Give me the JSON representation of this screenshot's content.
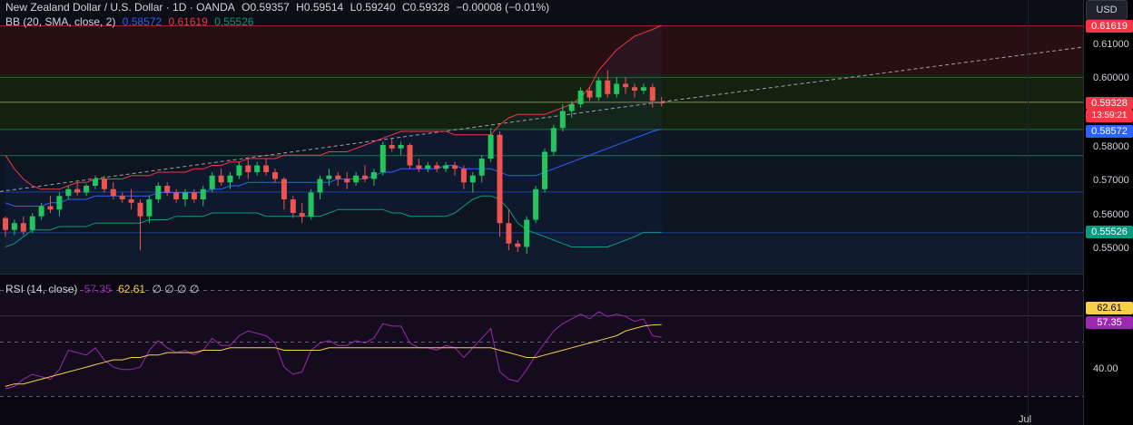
{
  "header": {
    "symbol": "New Zealand Dollar / U.S. Dollar · 1D · OANDA",
    "open_label": "O",
    "open": "0.59357",
    "high_label": "H",
    "high": "0.59514",
    "low_label": "L",
    "low": "0.59240",
    "close_label": "C",
    "close": "0.59328",
    "change": "−0.00008 (−0.01%)"
  },
  "bb_legend": {
    "label": "BB (20, SMA, close, 2)",
    "basis": "0.58572",
    "upper": "0.61619",
    "lower": "0.55526"
  },
  "rsi_legend": {
    "label": "RSI (14, close)",
    "rsi": "57.35",
    "ma": "62.61",
    "extra": "∅ ∅ ∅ ∅"
  },
  "currency_button": "USD",
  "price_axis": {
    "labels": [
      "0.61000",
      "0.60000",
      "0.58000",
      "0.57000",
      "0.56000",
      "0.55000"
    ],
    "upper_tag": "0.61619",
    "close_tag": "0.59328",
    "countdown": "13:59:21",
    "basis_tag": "0.58572",
    "lower_tag": "0.55526"
  },
  "rsi_axis": {
    "ma_tag": "62.61",
    "rsi_tag": "57.35",
    "label_40": "40.00"
  },
  "time_axis": {
    "label": "Jul"
  },
  "colors": {
    "up": "#26a69a",
    "up_body": "#22c55e",
    "down": "#ef5350",
    "bb_upper": "#f23645",
    "bb_basis": "#2962ff",
    "bb_lower": "#089981",
    "rsi": "#9c27b0",
    "rsi_ma": "#f7d046"
  },
  "chart_data": {
    "type": "candlestick",
    "price_range": [
      0.5485,
      0.6165
    ],
    "candles": [
      [
        0.5595,
        0.56,
        0.554,
        0.556
      ],
      [
        0.556,
        0.559,
        0.5545,
        0.558
      ],
      [
        0.558,
        0.56,
        0.5545,
        0.5555
      ],
      [
        0.556,
        0.561,
        0.555,
        0.56
      ],
      [
        0.56,
        0.564,
        0.559,
        0.563
      ],
      [
        0.563,
        0.566,
        0.561,
        0.562
      ],
      [
        0.562,
        0.567,
        0.56,
        0.566
      ],
      [
        0.566,
        0.569,
        0.565,
        0.568
      ],
      [
        0.568,
        0.57,
        0.566,
        0.567
      ],
      [
        0.567,
        0.5695,
        0.566,
        0.569
      ],
      [
        0.569,
        0.572,
        0.568,
        0.571
      ],
      [
        0.571,
        0.572,
        0.567,
        0.568
      ],
      [
        0.568,
        0.57,
        0.565,
        0.566
      ],
      [
        0.566,
        0.567,
        0.564,
        0.565
      ],
      [
        0.565,
        0.568,
        0.562,
        0.564
      ],
      [
        0.564,
        0.565,
        0.55,
        0.56
      ],
      [
        0.56,
        0.566,
        0.558,
        0.565
      ],
      [
        0.565,
        0.57,
        0.564,
        0.569
      ],
      [
        0.569,
        0.57,
        0.566,
        0.567
      ],
      [
        0.567,
        0.568,
        0.564,
        0.565
      ],
      [
        0.565,
        0.568,
        0.563,
        0.567
      ],
      [
        0.567,
        0.568,
        0.564,
        0.565
      ],
      [
        0.565,
        0.569,
        0.563,
        0.568
      ],
      [
        0.568,
        0.573,
        0.567,
        0.572
      ],
      [
        0.572,
        0.574,
        0.569,
        0.57
      ],
      [
        0.57,
        0.573,
        0.568,
        0.572
      ],
      [
        0.572,
        0.576,
        0.571,
        0.575
      ],
      [
        0.575,
        0.577,
        0.571,
        0.573
      ],
      [
        0.573,
        0.576,
        0.572,
        0.575
      ],
      [
        0.575,
        0.577,
        0.572,
        0.573
      ],
      [
        0.573,
        0.574,
        0.57,
        0.571
      ],
      [
        0.571,
        0.5715,
        0.562,
        0.565
      ],
      [
        0.565,
        0.566,
        0.5595,
        0.561
      ],
      [
        0.561,
        0.564,
        0.558,
        0.56
      ],
      [
        0.56,
        0.568,
        0.559,
        0.567
      ],
      [
        0.567,
        0.572,
        0.565,
        0.571
      ],
      [
        0.571,
        0.574,
        0.569,
        0.572
      ],
      [
        0.572,
        0.573,
        0.569,
        0.571
      ],
      [
        0.571,
        0.573,
        0.568,
        0.57
      ],
      [
        0.57,
        0.573,
        0.569,
        0.572
      ],
      [
        0.572,
        0.575,
        0.57,
        0.571
      ],
      [
        0.571,
        0.574,
        0.569,
        0.573
      ],
      [
        0.573,
        0.582,
        0.572,
        0.581
      ],
      [
        0.581,
        0.583,
        0.579,
        0.58
      ],
      [
        0.58,
        0.582,
        0.578,
        0.581
      ],
      [
        0.581,
        0.5815,
        0.574,
        0.575
      ],
      [
        0.575,
        0.577,
        0.573,
        0.574
      ],
      [
        0.574,
        0.576,
        0.573,
        0.575
      ],
      [
        0.575,
        0.576,
        0.573,
        0.574
      ],
      [
        0.574,
        0.576,
        0.573,
        0.575
      ],
      [
        0.575,
        0.576,
        0.572,
        0.574
      ],
      [
        0.574,
        0.575,
        0.568,
        0.57
      ],
      [
        0.57,
        0.573,
        0.567,
        0.572
      ],
      [
        0.572,
        0.578,
        0.57,
        0.577
      ],
      [
        0.577,
        0.586,
        0.576,
        0.584
      ],
      [
        0.584,
        0.585,
        0.554,
        0.558
      ],
      [
        0.558,
        0.562,
        0.55,
        0.552
      ],
      [
        0.552,
        0.553,
        0.5495,
        0.551
      ],
      [
        0.551,
        0.56,
        0.549,
        0.559
      ],
      [
        0.559,
        0.569,
        0.558,
        0.568
      ],
      [
        0.568,
        0.58,
        0.567,
        0.579
      ],
      [
        0.579,
        0.587,
        0.578,
        0.586
      ],
      [
        0.586,
        0.593,
        0.585,
        0.591
      ],
      [
        0.591,
        0.594,
        0.589,
        0.593
      ],
      [
        0.593,
        0.598,
        0.592,
        0.597
      ],
      [
        0.597,
        0.598,
        0.594,
        0.595
      ],
      [
        0.595,
        0.601,
        0.594,
        0.6
      ],
      [
        0.6,
        0.603,
        0.595,
        0.596
      ],
      [
        0.596,
        0.601,
        0.595,
        0.599
      ],
      [
        0.599,
        0.601,
        0.596,
        0.598
      ],
      [
        0.598,
        0.599,
        0.595,
        0.597
      ],
      [
        0.597,
        0.599,
        0.596,
        0.598
      ],
      [
        0.598,
        0.599,
        0.592,
        0.594
      ],
      [
        0.5935,
        0.5951,
        0.5924,
        0.5933
      ]
    ],
    "bb_upper": [
      0.578,
      0.574,
      0.571,
      0.569,
      0.568,
      0.568,
      0.568,
      0.569,
      0.57,
      0.57,
      0.571,
      0.571,
      0.571,
      0.571,
      0.572,
      0.572,
      0.572,
      0.573,
      0.573,
      0.573,
      0.573,
      0.574,
      0.574,
      0.575,
      0.575,
      0.576,
      0.576,
      0.577,
      0.577,
      0.577,
      0.577,
      0.578,
      0.578,
      0.578,
      0.578,
      0.578,
      0.579,
      0.579,
      0.579,
      0.58,
      0.581,
      0.582,
      0.583,
      0.584,
      0.585,
      0.585,
      0.585,
      0.585,
      0.585,
      0.585,
      0.584,
      0.584,
      0.584,
      0.584,
      0.584,
      0.587,
      0.589,
      0.59,
      0.59,
      0.59,
      0.59,
      0.591,
      0.592,
      0.593,
      0.595,
      0.598,
      0.603,
      0.606,
      0.609,
      0.611,
      0.613,
      0.614,
      0.615,
      0.6162
    ],
    "bb_basis": [
      0.564,
      0.563,
      0.563,
      0.563,
      0.563,
      0.564,
      0.564,
      0.565,
      0.565,
      0.565,
      0.566,
      0.566,
      0.566,
      0.566,
      0.566,
      0.566,
      0.566,
      0.567,
      0.567,
      0.567,
      0.567,
      0.567,
      0.567,
      0.568,
      0.568,
      0.569,
      0.569,
      0.57,
      0.57,
      0.57,
      0.57,
      0.57,
      0.57,
      0.57,
      0.57,
      0.57,
      0.57,
      0.571,
      0.571,
      0.571,
      0.571,
      0.572,
      0.573,
      0.573,
      0.574,
      0.574,
      0.574,
      0.574,
      0.574,
      0.575,
      0.575,
      0.574,
      0.574,
      0.574,
      0.574,
      0.573,
      0.572,
      0.572,
      0.572,
      0.572,
      0.573,
      0.574,
      0.575,
      0.576,
      0.577,
      0.578,
      0.579,
      0.58,
      0.581,
      0.582,
      0.583,
      0.584,
      0.585,
      0.5857
    ],
    "bb_lower": [
      0.551,
      0.552,
      0.554,
      0.556,
      0.556,
      0.556,
      0.557,
      0.557,
      0.557,
      0.557,
      0.558,
      0.558,
      0.558,
      0.558,
      0.558,
      0.558,
      0.559,
      0.559,
      0.559,
      0.56,
      0.56,
      0.56,
      0.56,
      0.561,
      0.561,
      0.561,
      0.561,
      0.561,
      0.561,
      0.56,
      0.56,
      0.56,
      0.56,
      0.56,
      0.56,
      0.56,
      0.561,
      0.562,
      0.562,
      0.562,
      0.562,
      0.562,
      0.562,
      0.561,
      0.561,
      0.56,
      0.56,
      0.56,
      0.56,
      0.56,
      0.561,
      0.563,
      0.565,
      0.566,
      0.566,
      0.565,
      0.562,
      0.558,
      0.556,
      0.555,
      0.554,
      0.553,
      0.552,
      0.551,
      0.551,
      0.551,
      0.551,
      0.551,
      0.552,
      0.553,
      0.554,
      0.5553,
      0.5553,
      0.5553
    ],
    "rsi": [
      36,
      37,
      40,
      42,
      41,
      40,
      44,
      52,
      51,
      50,
      53,
      48,
      45,
      44,
      44,
      45,
      52,
      56,
      53,
      51,
      52,
      50,
      52,
      57,
      54,
      54,
      58,
      60,
      59,
      58,
      55,
      45,
      42,
      43,
      52,
      55,
      56,
      54,
      54,
      56,
      55,
      57,
      63,
      62,
      62,
      55,
      53,
      53,
      52,
      54,
      53,
      49,
      53,
      57,
      61,
      43,
      40,
      39,
      44,
      50,
      55,
      60,
      63,
      65,
      67,
      65,
      68,
      66,
      67,
      66,
      64,
      65,
      58,
      57.35
    ],
    "rsi_ma": [
      37,
      38,
      38,
      39,
      40,
      41,
      42,
      43,
      44,
      45,
      46,
      47,
      48,
      48,
      49,
      49,
      50,
      50,
      51,
      51,
      51,
      51,
      52,
      52,
      52,
      53,
      53,
      53,
      53,
      53,
      53,
      52,
      52,
      52,
      52,
      52,
      53,
      53,
      53,
      53,
      53,
      53,
      53,
      53,
      53,
      53,
      53,
      53,
      53,
      53,
      53,
      53,
      53,
      53,
      53,
      52,
      51,
      50,
      49,
      49,
      50,
      51,
      52,
      53,
      54,
      55,
      56,
      57,
      58,
      60,
      61,
      62,
      62.5,
      62.61
    ],
    "rsi_range": [
      33,
      77
    ]
  }
}
